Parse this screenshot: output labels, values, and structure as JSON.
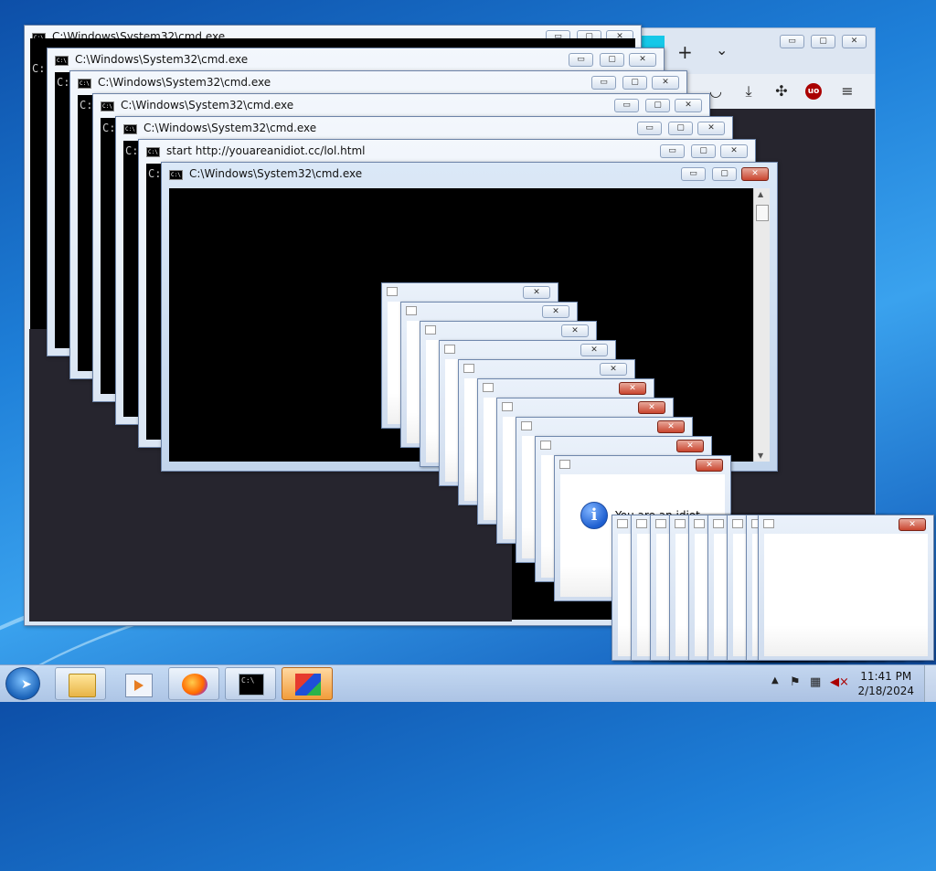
{
  "cmd_windows": [
    {
      "title": "C:\\Windows\\System32\\cmd.exe",
      "prompt": "C:"
    },
    {
      "title": "C:\\Windows\\System32\\cmd.exe",
      "prompt": "C:"
    },
    {
      "title": "C:\\Windows\\System32\\cmd.exe",
      "prompt": "C:"
    },
    {
      "title": "C:\\Windows\\System32\\cmd.exe",
      "prompt": "C:"
    },
    {
      "title": "C:\\Windows\\System32\\cmd.exe",
      "prompt": "C:"
    },
    {
      "title": "start  http://youareanidiot.cc/lol.html",
      "prompt": "C:"
    },
    {
      "title": "C:\\Windows\\System32\\cmd.exe",
      "prompt": ""
    }
  ],
  "icons": {
    "min": "▭",
    "max": "▢",
    "close": "✕",
    "cmd_icon_text": "C:\\",
    "info": "i",
    "new_tab": "+",
    "chevron": "⌄",
    "ubo": "uo"
  },
  "message_box": {
    "text": "You are an idiot"
  },
  "taskbar": {
    "time": "11:41 PM",
    "date": "2/18/2024",
    "items": [
      "Windows Explorer",
      "Windows Media Player",
      "Firefox",
      "Command Prompt",
      "Blender-like app"
    ]
  },
  "colors": {
    "accent": "#16c8e8",
    "close_red": "#c9452f"
  }
}
